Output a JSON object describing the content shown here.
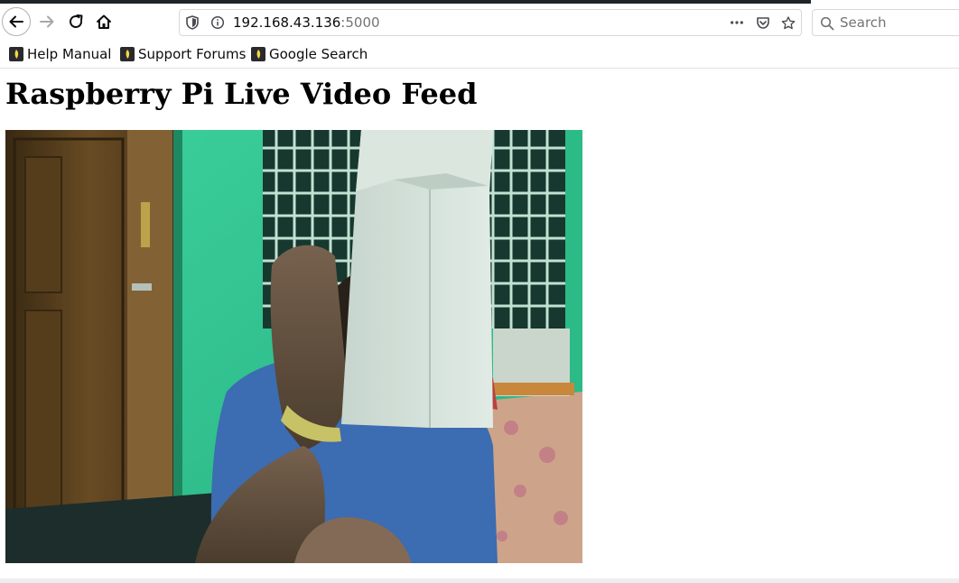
{
  "browser": {
    "url_host": "192.168.43.136",
    "url_port": ":5000",
    "search_placeholder": "Search",
    "bookmarks": [
      {
        "label": "Help Manual"
      },
      {
        "label": "Support Forums"
      },
      {
        "label": "Google Search"
      }
    ]
  },
  "page": {
    "title": "Raspberry Pi Live Video Feed"
  },
  "colors": {
    "wall": "#3fd9a4",
    "door": "#5e3d1c",
    "card": "#e2ece6",
    "shirt": "#3f6db8"
  }
}
